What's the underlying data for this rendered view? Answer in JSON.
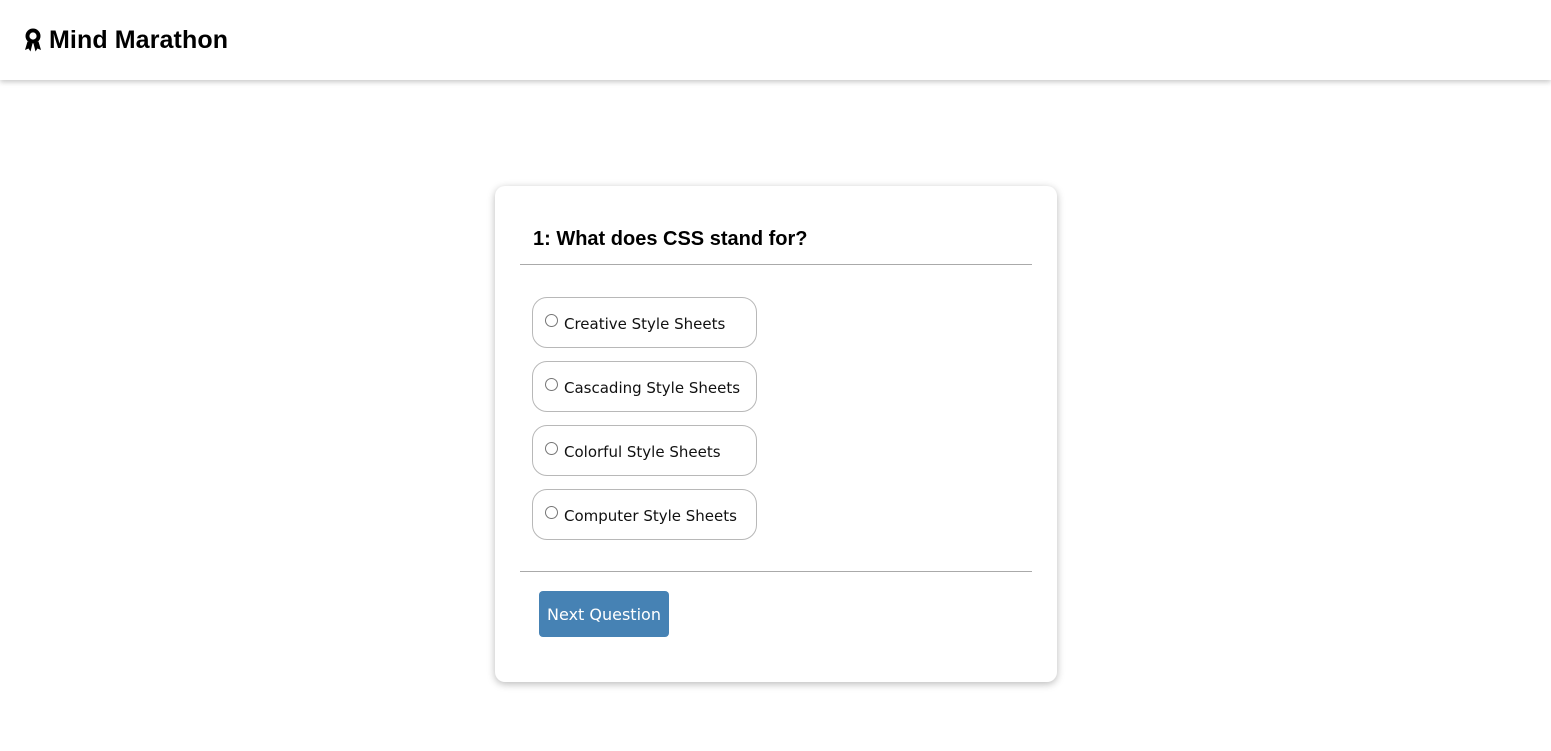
{
  "header": {
    "icon": "award-ribbon-icon",
    "title": "Mind Marathon"
  },
  "quiz": {
    "question": "1: What does CSS stand for?",
    "options": [
      {
        "label": "Creative Style Sheets",
        "selected": false
      },
      {
        "label": "Cascading Style Sheets",
        "selected": false
      },
      {
        "label": "Colorful Style Sheets",
        "selected": false
      },
      {
        "label": "Computer Style Sheets",
        "selected": false
      }
    ],
    "next_label": "Next Question"
  },
  "colors": {
    "accent": "#4682b4",
    "border": "#b8b8b8",
    "divider": "#aaaaaa"
  }
}
